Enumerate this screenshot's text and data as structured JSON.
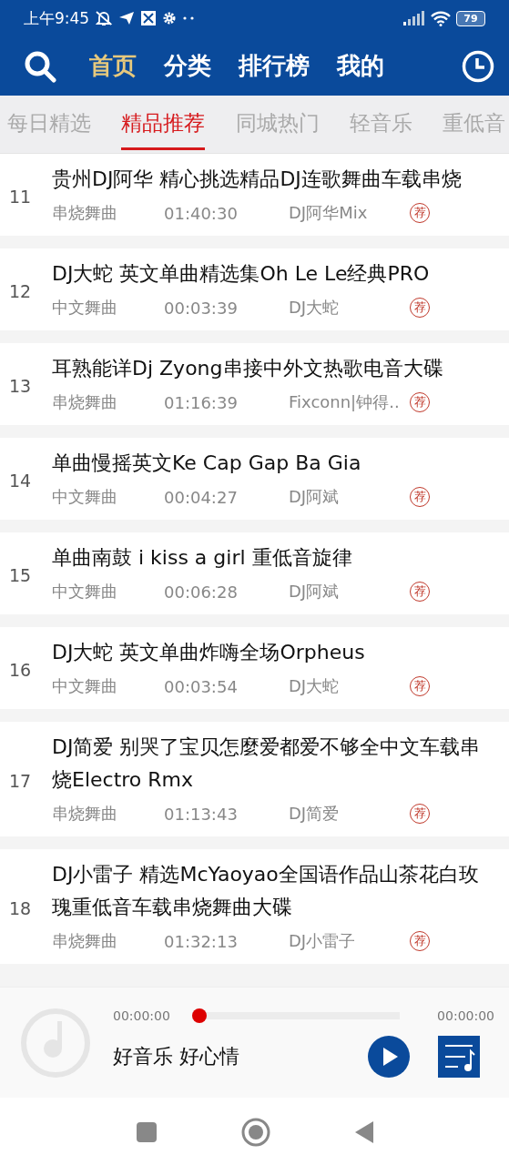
{
  "status_bar": {
    "time": "上午9:45",
    "battery": "79"
  },
  "nav": {
    "tabs": [
      {
        "label": "首页",
        "selected": true
      },
      {
        "label": "分类",
        "selected": false
      },
      {
        "label": "排行榜",
        "selected": false
      },
      {
        "label": "我的",
        "selected": false
      }
    ]
  },
  "sub_tabs": [
    {
      "label": "每日精选",
      "selected": false
    },
    {
      "label": "精品推荐",
      "selected": true
    },
    {
      "label": "同城热门",
      "selected": false
    },
    {
      "label": "轻音乐",
      "selected": false
    },
    {
      "label": "重低音",
      "selected": false
    }
  ],
  "songs": [
    {
      "number": "11",
      "title": "贵州DJ阿华 精心挑选精品DJ连歌舞曲车载串烧",
      "genre": "串烧舞曲",
      "duration": "01:40:30",
      "artist": "DJ阿华Mix",
      "badge": "荐"
    },
    {
      "number": "12",
      "title": "DJ大蛇 英文单曲精选集Oh Le Le经典PRO",
      "genre": "中文舞曲",
      "duration": "00:03:39",
      "artist": "DJ大蛇",
      "badge": "荐"
    },
    {
      "number": "13",
      "title": "耳熟能详Dj Zyong串接中外文热歌电音大碟",
      "genre": "串烧舞曲",
      "duration": "01:16:39",
      "artist": "Fixconn|钟得..",
      "badge": "荐"
    },
    {
      "number": "14",
      "title": "单曲慢摇英文Ke Cap Gap Ba Gia",
      "genre": "中文舞曲",
      "duration": "00:04:27",
      "artist": "DJ阿斌",
      "badge": "荐"
    },
    {
      "number": "15",
      "title": "单曲南鼓 i kiss a girl 重低音旋律",
      "genre": "中文舞曲",
      "duration": "00:06:28",
      "artist": "DJ阿斌",
      "badge": "荐"
    },
    {
      "number": "16",
      "title": "DJ大蛇 英文单曲炸嗨全场Orpheus",
      "genre": "中文舞曲",
      "duration": "00:03:54",
      "artist": "DJ大蛇",
      "badge": "荐"
    },
    {
      "number": "17",
      "title": "DJ简爱 别哭了宝贝怎麼爱都爱不够全中文车载串烧Electro Rmx",
      "genre": "串烧舞曲",
      "duration": "01:13:43",
      "artist": "DJ简爱",
      "badge": "荐"
    },
    {
      "number": "18",
      "title": "DJ小雷子 精选McYaoyao全国语作品山茶花白玫瑰重低音车载串烧舞曲大碟",
      "genre": "串烧舞曲",
      "duration": "01:32:13",
      "artist": "DJ小雷子",
      "badge": "荐"
    }
  ],
  "player": {
    "elapsed": "00:00:00",
    "total": "00:00:00",
    "level": 0,
    "title": "好音乐 好心情"
  }
}
